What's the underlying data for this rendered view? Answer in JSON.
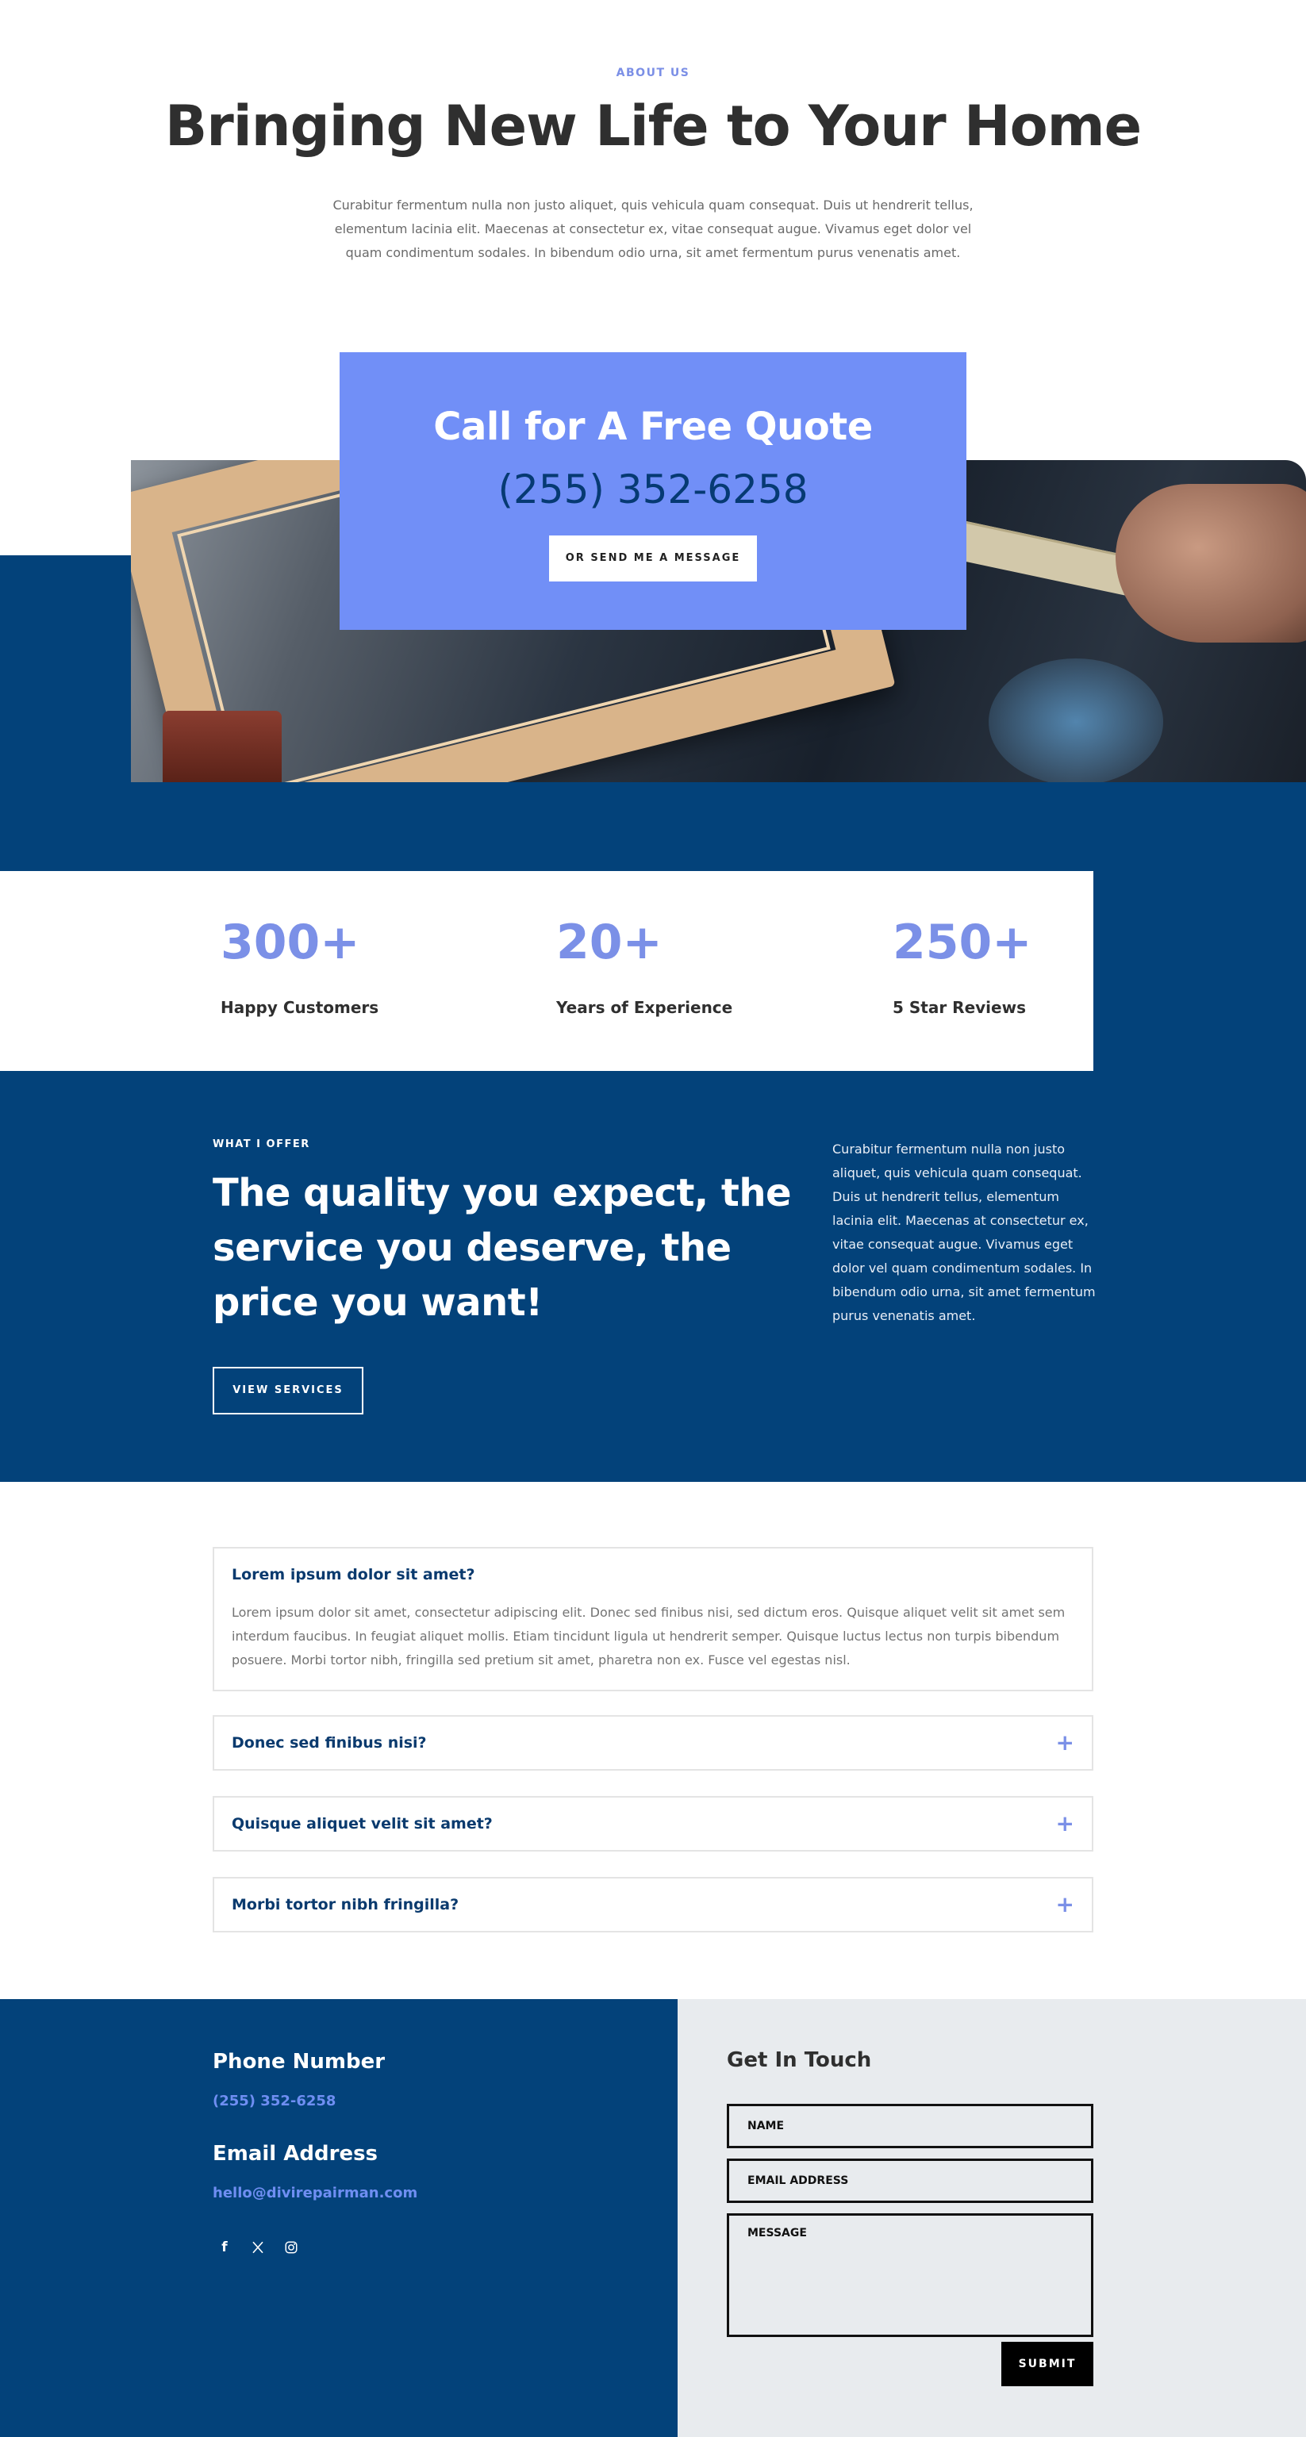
{
  "about": {
    "kicker": "ABOUT US",
    "title": "Bringing New Life to Your Home",
    "text": "Curabitur fermentum nulla non justo aliquet, quis vehicula quam consequat. Duis ut hendrerit tellus, elementum lacinia elit. Maecenas at consectetur ex, vitae consequat augue. Vivamus eget dolor vel quam condimentum sodales. In bibendum odio urna, sit amet fermentum purus venenatis amet."
  },
  "quote": {
    "title": "Call for A Free Quote",
    "phone": "(255) 352-6258",
    "button_label": "OR SEND ME A MESSAGE"
  },
  "stats": [
    {
      "number": "300+",
      "label": "Happy Customers"
    },
    {
      "number": "20+",
      "label": "Years of Experience"
    },
    {
      "number": "250+",
      "label": "5 Star Reviews"
    }
  ],
  "offer": {
    "kicker": "WHAT I OFFER",
    "title": "The quality you expect, the service you deserve, the price you want!",
    "button_label": "VIEW SERVICES",
    "text": "Curabitur fermentum nulla non justo aliquet, quis vehicula quam consequat. Duis ut hendrerit tellus, elementum lacinia elit. Maecenas at consectetur ex, vitae consequat augue. Vivamus eget dolor vel quam condimentum sodales. In bibendum odio urna, sit amet fermentum purus venenatis amet."
  },
  "faq": [
    {
      "question": "Lorem ipsum dolor sit amet?",
      "answer": "Lorem ipsum dolor sit amet, consectetur adipiscing elit. Donec sed finibus nisi, sed dictum eros. Quisque aliquet velit sit amet sem interdum faucibus. In feugiat aliquet mollis. Etiam tincidunt ligula ut hendrerit semper. Quisque luctus lectus non turpis bibendum posuere. Morbi tortor nibh, fringilla sed pretium sit amet, pharetra non ex. Fusce vel egestas nisl.",
      "expanded": true
    },
    {
      "question": "Donec sed finibus nisi?",
      "expanded": false
    },
    {
      "question": "Quisque aliquet velit sit amet?",
      "expanded": false
    },
    {
      "question": "Morbi tortor nibh fringilla?",
      "expanded": false
    }
  ],
  "faq_toggle_icon": "+",
  "footer": {
    "phone_heading": "Phone Number",
    "phone": "(255) 352-6258",
    "email_heading": "Email Address",
    "email": "hello@divirepairman.com",
    "social_icons": [
      "facebook-icon",
      "x-icon",
      "instagram-icon"
    ],
    "facebook_glyph": "f"
  },
  "contact_form": {
    "title": "Get In Touch",
    "name_placeholder": "NAME",
    "email_placeholder": "EMAIL ADDRESS",
    "message_placeholder": "MESSAGE",
    "submit_label": "SUBMIT"
  },
  "colors": {
    "navy": "#03427a",
    "accent_blue": "#718ff7",
    "stat_blue": "#7b90e7",
    "footer_gray": "#e8ebee"
  }
}
